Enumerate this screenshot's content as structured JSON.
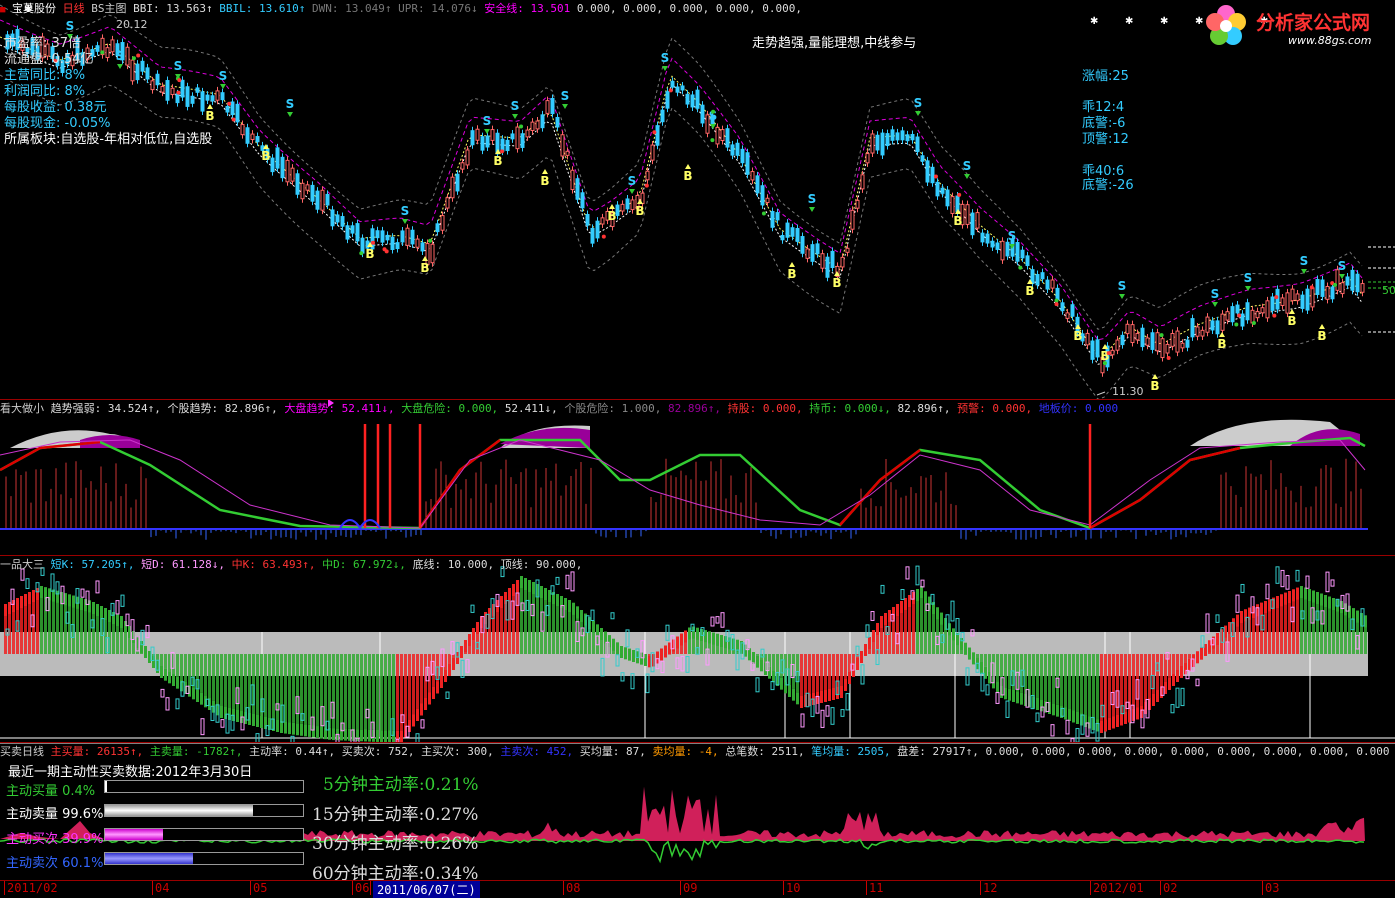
{
  "main_header": {
    "stock": "宝莫股份",
    "period": "日线",
    "indicator": "BS主图",
    "bbi": "BBI: 13.563↑",
    "bbil": "BBIL: 13.610↑",
    "dwn": "DWN: 13.049↑",
    "upr": "UPR: 14.076↓",
    "safe": "安全线: 13.501",
    "rest": "0.000, 0.000, 0.000, 0.000, 0.000,"
  },
  "stock_info": {
    "pe": "市盈率:    37倍",
    "net": "流通盘:   0.54亿",
    "rev": "主营同比:  8%",
    "profit": "利润同比:  8%",
    "eps": "每股收益:  0.38元",
    "cash": "每股现金:  -0.05%",
    "sector": "所属板块:自选股-年相对低位,自选股"
  },
  "annotation": "走势趋强,量能理想,中线参与",
  "side_info": {
    "rise": "涨幅:25",
    "p12": "乖12:4",
    "bot1": "底警:-6",
    "top1": "顶警:12",
    "p40": "乖40:6",
    "bot2": "底警:-26"
  },
  "price_labels": {
    "high": "20.12",
    "low": "11.30",
    "right": "50"
  },
  "panel2_header": {
    "name": "看大做小",
    "items": [
      "趋势强弱: 34.524↑,",
      "个股趋势: 82.896↑,",
      "大盘趋势: 52.411↓,",
      "大盘危险: 0.000,",
      "52.411↓,",
      "个股危险: 1.000,",
      "82.896↑,",
      "持股: 0.000,",
      "持币: 0.000↓,",
      "82.896↑,",
      "预警: 0.000,",
      "地板价: 0.000"
    ]
  },
  "panel3_header": {
    "name": "一品大三",
    "items": [
      "短K: 57.205↑,",
      "短D: 61.128↓,",
      "中K: 63.493↑,",
      "中D: 67.972↓,",
      "底线: 10.000,",
      "顶线: 90.000,"
    ]
  },
  "panel4_header": {
    "name": "买卖日线",
    "items": [
      "主买量: 26135↑,",
      "主卖量: -1782↑,",
      "主动率: 0.44↑,",
      "买卖次: 752,",
      "主买次: 300,",
      "主卖次: 452,",
      "买均量: 87,",
      "卖均量: -4,",
      "总笔数: 2511,",
      "笔均量: 2505,",
      "盘差: 27917↑,",
      "0.000, 0.000, 0.000, 0.000, 0.000, 0.000, 0.000, 0.000, 0.000,"
    ]
  },
  "active_data": {
    "title": "最近一期主动性买卖数据:2012年3月30日",
    "buy_vol": "主动买量 0.4%",
    "sell_vol": "主动卖量 99.6%",
    "buy_cnt": "主动买次 39.9%",
    "sell_cnt": "主动卖次 60.1%",
    "buy_vol_pct": 0.4,
    "sell_vol_pct": 99.6,
    "buy_cnt_pct": 39.9,
    "sell_cnt_pct": 60.1,
    "r5": "5分钟主动率:0.21%",
    "r15": "15分钟主动率:0.27%",
    "r30": "30分钟主动率:0.26%",
    "r60": "60分钟主动率:0.34%"
  },
  "x_axis": [
    "2011/02",
    "04",
    "05",
    "06",
    "2011/06/07(二)",
    "08",
    "09",
    "10",
    "11",
    "12",
    "2012/01",
    "02",
    "03"
  ],
  "logo": {
    "text": "分析家公式网",
    "url": "www.88gs.com"
  }
}
